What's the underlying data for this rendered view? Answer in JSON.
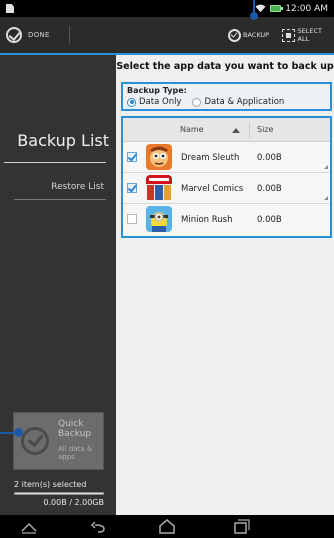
{
  "status_bar": {
    "time": "12:00 AM"
  },
  "action_bar": {
    "done_label": "DONE",
    "backup_label": "BACKUP",
    "select_all_label": "SELECT ALL"
  },
  "sidebar": {
    "title": "Backup List",
    "restore_label": "Restore List",
    "quick_backup": {
      "title": "Quick Backup",
      "subtitle": "All data & apps"
    },
    "selected_count": "2 item(s) selected",
    "size_usage": "0.00B / 2.00GB",
    "progress": 0.0
  },
  "main": {
    "instruction": "Select the app data you want to back up",
    "backup_type_label": "Backup Type:",
    "options": [
      {
        "label": "Data Only",
        "selected": true
      },
      {
        "label": "Data & Application",
        "selected": false
      }
    ]
  },
  "table": {
    "headers": {
      "name": "Name",
      "size": "Size"
    },
    "rows": [
      {
        "name": "Dream Sleuth",
        "size": "0.00B",
        "checked": true,
        "icon": "dream-sleuth-icon"
      },
      {
        "name": "Marvel Comics",
        "size": "0.00B",
        "checked": true,
        "icon": "marvel-comics-icon"
      },
      {
        "name": "Minion Rush",
        "size": "0.00B",
        "checked": false,
        "icon": "minion-rush-icon"
      }
    ]
  },
  "colors": {
    "accent_blue": "#2b8fd6",
    "callout_blue": "#1a5aa8",
    "sidebar_bg": "#333333",
    "main_bg": "#efefef"
  }
}
